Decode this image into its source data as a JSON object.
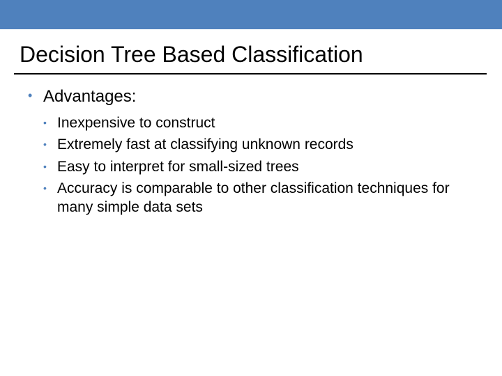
{
  "title": "Decision Tree Based Classification",
  "lvl1_heading": "Advantages:",
  "bullets": [
    "Inexpensive to construct",
    "Extremely fast at classifying unknown records",
    "Easy to interpret for small-sized trees",
    "Accuracy is comparable to other classification techniques for many simple data sets"
  ]
}
